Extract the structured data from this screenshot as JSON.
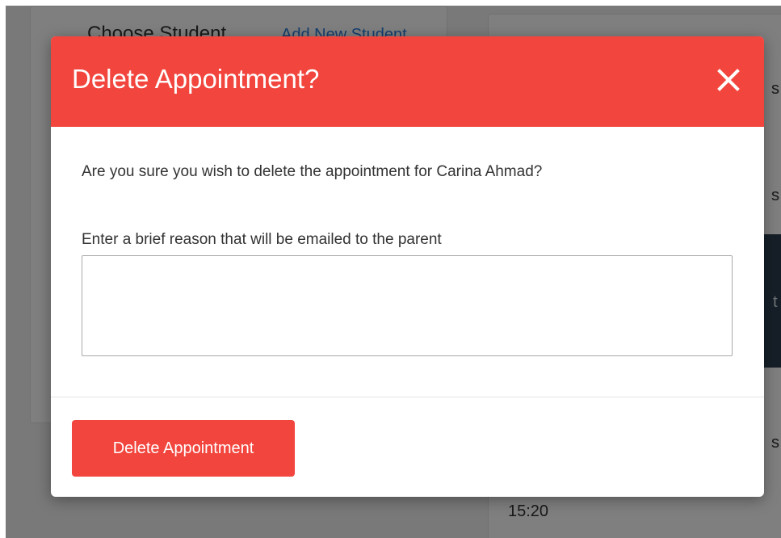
{
  "background": {
    "tabs": {
      "active": "Choose Student",
      "link": "Add New Student"
    },
    "snippets": [
      "s",
      "s",
      "t",
      "s"
    ],
    "time": "15:20"
  },
  "modal": {
    "title": "Delete Appointment?",
    "close_icon": "close-icon",
    "confirm_text": "Are you sure you wish to delete the appointment for Carina Ahmad?",
    "reason_label": "Enter a brief reason that will be emailed to the parent",
    "reason_value": "",
    "reason_placeholder": "",
    "delete_button_label": "Delete Appointment"
  },
  "colors": {
    "accent": "#f2453d",
    "overlay": "rgba(0,0,0,0.5)",
    "text": "#333333"
  }
}
